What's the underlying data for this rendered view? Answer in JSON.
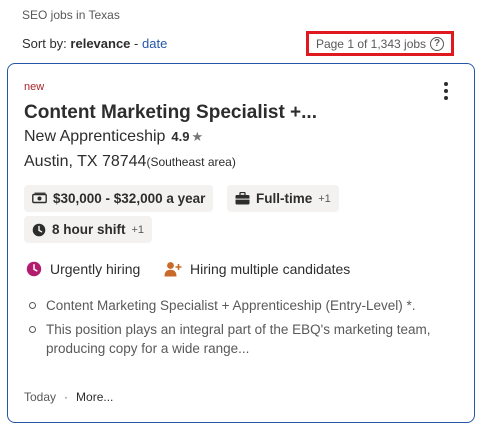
{
  "header": {
    "breadcrumb": "SEO jobs in Texas",
    "sort_prefix": "Sort by:",
    "sort_active": "relevance",
    "sort_separator": "-",
    "sort_alt": "date",
    "page_count": "Page 1 of 1,343 jobs",
    "help_icon": "help-circle-icon",
    "highlight_color": "#e0191f"
  },
  "job": {
    "badge": "new",
    "title": "Content Marketing Specialist +...",
    "company": "New Apprenticeship",
    "rating": "4.9",
    "location": "Austin, TX 78744",
    "area": "(Southeast area)",
    "salary": "$30,000 - $32,000 a year",
    "job_type": "Full-time",
    "job_type_more": "+1",
    "shift": "8 hour shift",
    "shift_more": "+1",
    "urgent_label": "Urgently hiring",
    "multiple_label": "Hiring multiple candidates",
    "snippet": [
      "Content Marketing Specialist + Apprenticeship (Entry-Level) *.",
      "This position plays an integral part of the EBQ's marketing team, producing copy for a wide range..."
    ],
    "posted": "Today",
    "dot": "·",
    "more": "More...",
    "accent_color": "#2557a7",
    "urgent_color": "#b31b6f",
    "multiple_color": "#c96a2a"
  }
}
